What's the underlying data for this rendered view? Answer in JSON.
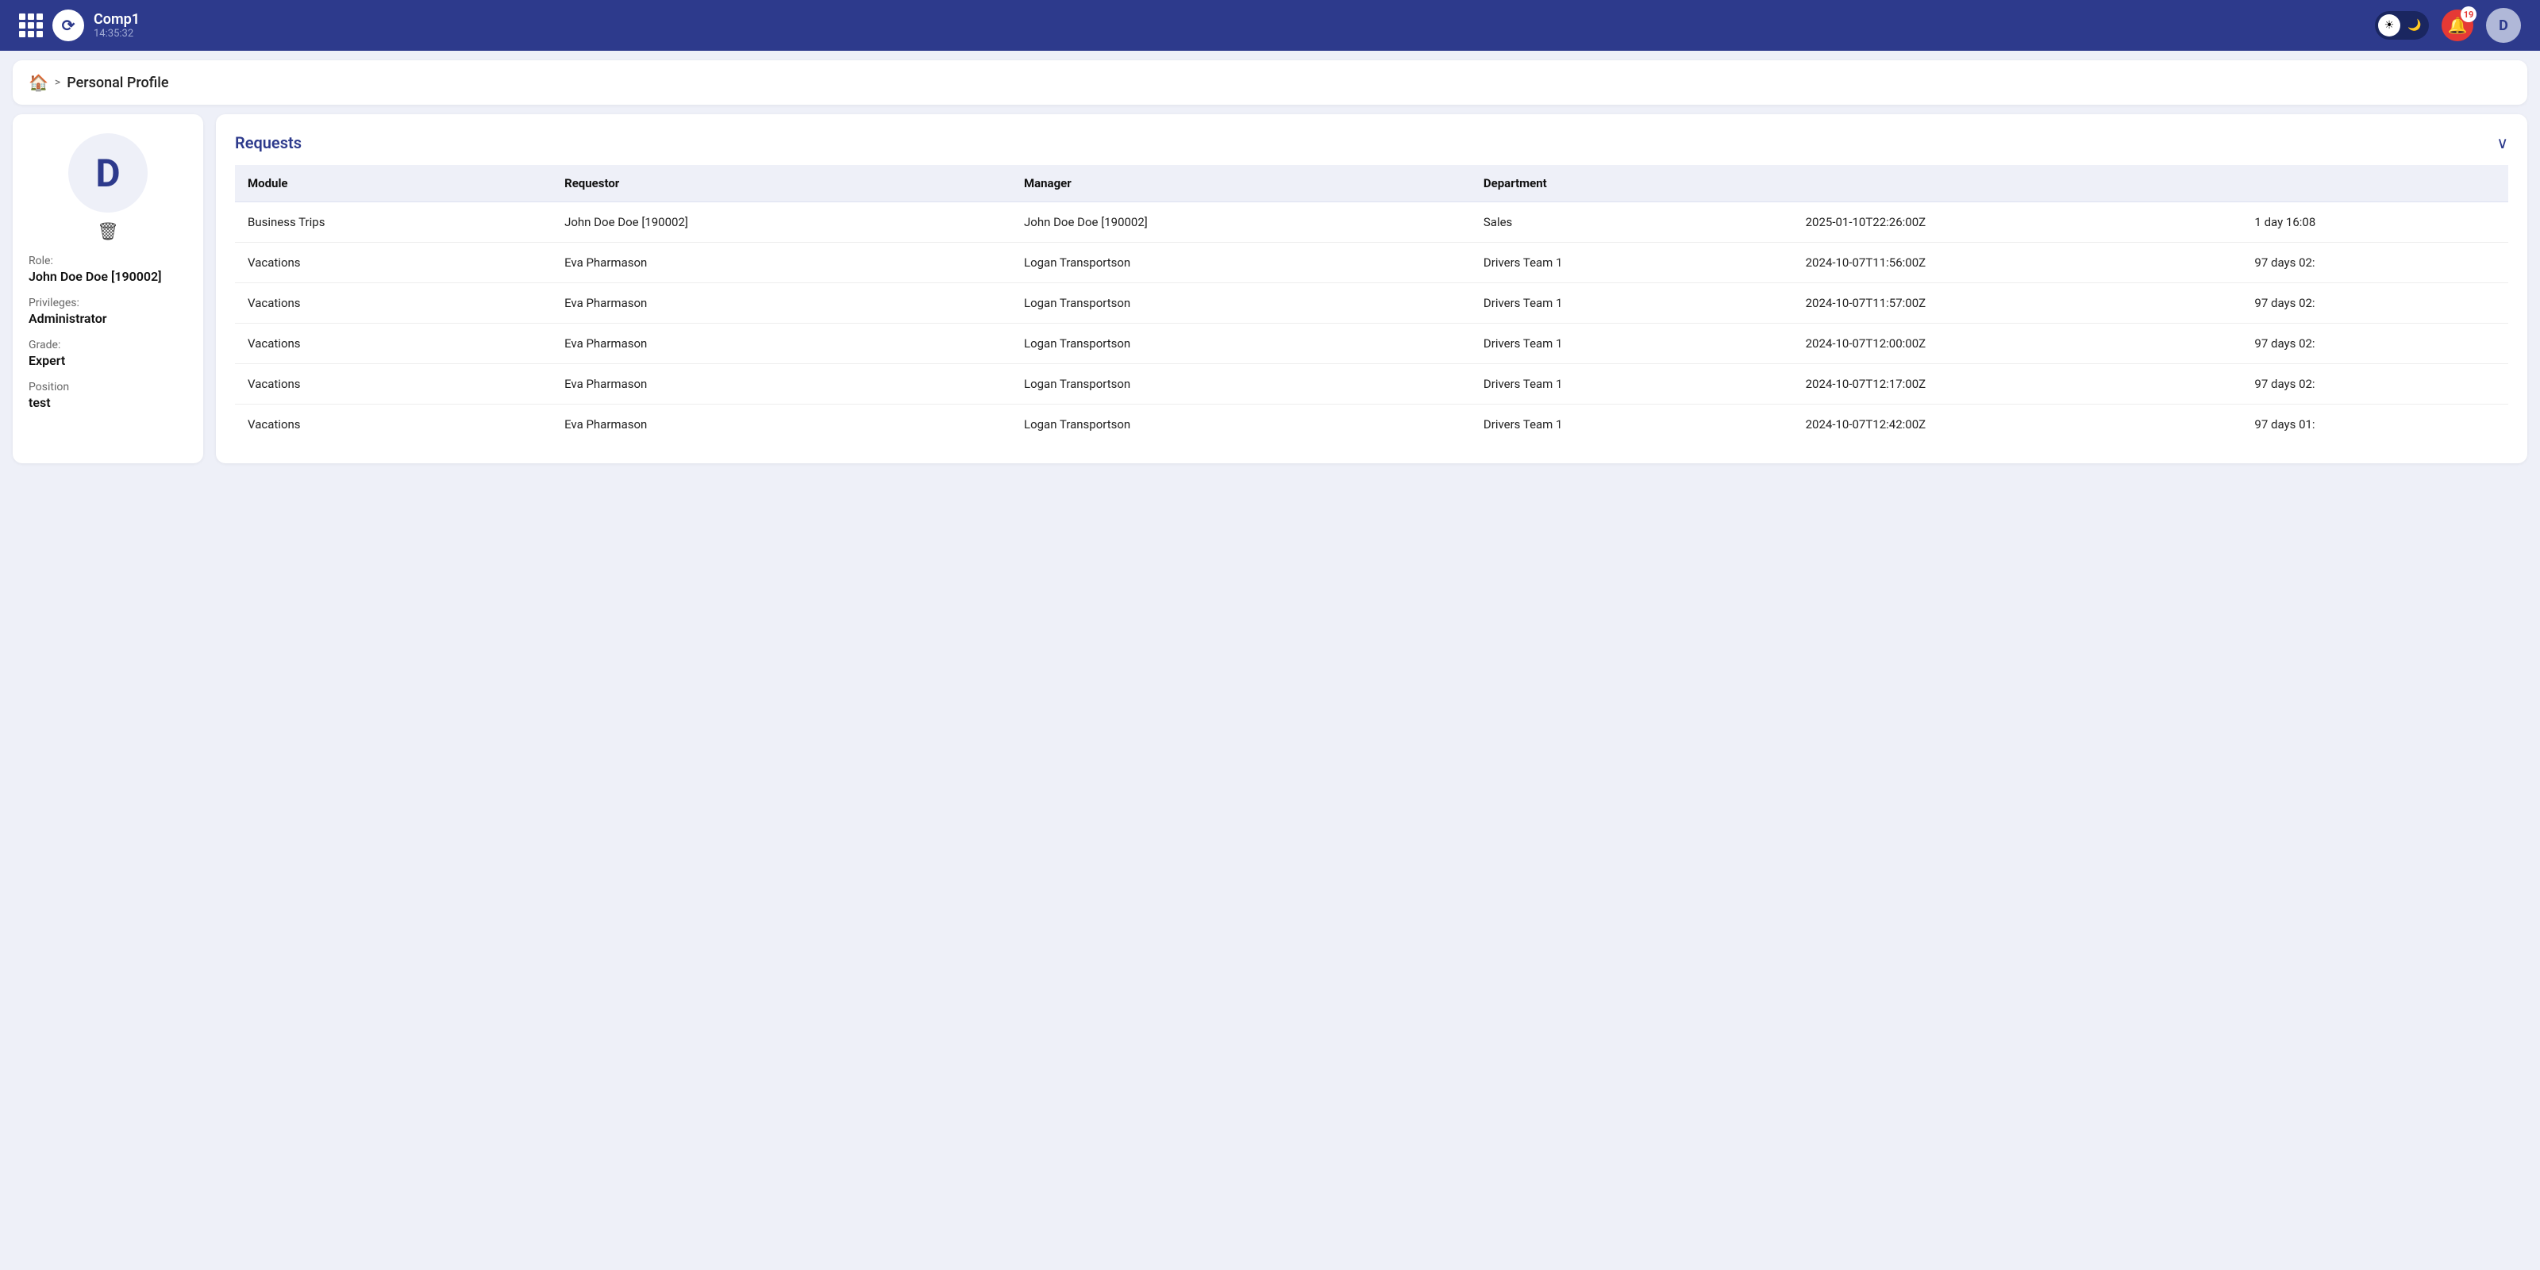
{
  "app": {
    "name": "Comp1",
    "time": "14:35:32",
    "logo_letter": "⟳"
  },
  "topbar": {
    "theme_light_label": "☀",
    "theme_dark_label": "🌙",
    "notification_count": "19",
    "user_initial": "D"
  },
  "breadcrumb": {
    "home_icon": "🏠",
    "separator": ">",
    "current_page": "Personal Profile"
  },
  "profile": {
    "avatar_letter": "D",
    "role_label": "Role:",
    "role_value": "John Doe Doe [190002]",
    "privileges_label": "Privileges:",
    "privileges_value": "Administrator",
    "grade_label": "Grade:",
    "grade_value": "Expert",
    "position_label": "Position",
    "position_value": "test"
  },
  "requests": {
    "title": "Requests",
    "collapse_icon": "∨",
    "table": {
      "columns": [
        "Module",
        "Requestor",
        "Manager",
        "Department",
        "",
        ""
      ],
      "rows": [
        {
          "module": "Business Trips",
          "requestor": "John Doe Doe [190002]",
          "manager": "John Doe Doe [190002]",
          "department": "Sales",
          "date": "2025-01-10T22:26:00Z",
          "duration": "1 day 16:08"
        },
        {
          "module": "Vacations",
          "requestor": "Eva Pharmason",
          "manager": "Logan Transportson",
          "department": "Drivers Team 1",
          "date": "2024-10-07T11:56:00Z",
          "duration": "97 days 02:"
        },
        {
          "module": "Vacations",
          "requestor": "Eva Pharmason",
          "manager": "Logan Transportson",
          "department": "Drivers Team 1",
          "date": "2024-10-07T11:57:00Z",
          "duration": "97 days 02:"
        },
        {
          "module": "Vacations",
          "requestor": "Eva Pharmason",
          "manager": "Logan Transportson",
          "department": "Drivers Team 1",
          "date": "2024-10-07T12:00:00Z",
          "duration": "97 days 02:"
        },
        {
          "module": "Vacations",
          "requestor": "Eva Pharmason",
          "manager": "Logan Transportson",
          "department": "Drivers Team 1",
          "date": "2024-10-07T12:17:00Z",
          "duration": "97 days 02:"
        },
        {
          "module": "Vacations",
          "requestor": "Eva Pharmason",
          "manager": "Logan Transportson",
          "department": "Drivers Team 1",
          "date": "2024-10-07T12:42:00Z",
          "duration": "97 days 01:"
        }
      ]
    }
  }
}
